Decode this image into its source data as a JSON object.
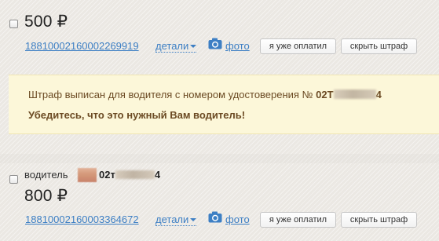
{
  "fines": [
    {
      "amount": "500 ₽",
      "doc_number": "18810002160002269919",
      "details_label": "детали",
      "photo_label": "фото",
      "paid_button": "я уже оплатил",
      "hide_button": "скрыть штраф",
      "notice": {
        "text_prefix": "Штраф выписан для водителя с номером удостоверения №",
        "license_start": "02Т",
        "license_end": "4",
        "warning": "Убедитесь, что это нужный Вам водитель!"
      }
    },
    {
      "driver_label": "водитель",
      "driver_license_start": "02т",
      "driver_license_end": "4",
      "amount": "800 ₽",
      "doc_number": "18810002160003364672",
      "details_label": "детали",
      "photo_label": "фото",
      "paid_button": "я уже оплатил",
      "hide_button": "скрыть штраф"
    }
  ],
  "colors": {
    "link": "#3d7fc4",
    "notice_bg": "#fcf7d9",
    "notice_text": "#6b4a23"
  }
}
